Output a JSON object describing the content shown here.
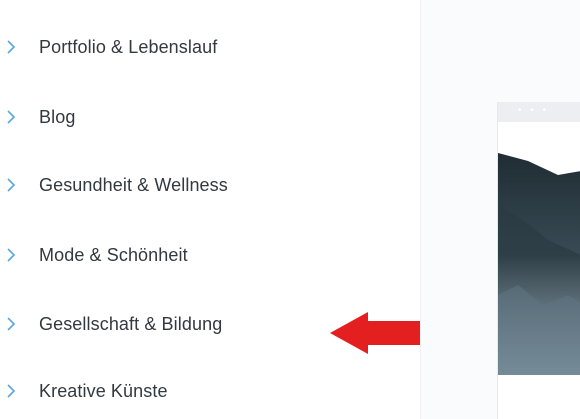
{
  "categories": [
    {
      "label": "Portfolio & Lebenslauf"
    },
    {
      "label": "Blog"
    },
    {
      "label": "Gesundheit & Wellness"
    },
    {
      "label": "Mode & Schönheit"
    },
    {
      "label": "Gesellschaft & Bildung"
    },
    {
      "label": "Kreative Künste"
    }
  ],
  "colors": {
    "text": "#32393f",
    "chevron": "#5aa6e0",
    "arrow": "#e41f1f",
    "browser_bar": "#eceef1"
  },
  "icons": {
    "item": "chevron-right-icon",
    "annotation": "red-arrow-left-icon",
    "browser_dots": "ellipsis-icon"
  },
  "preview": {
    "dots": "• • •"
  }
}
